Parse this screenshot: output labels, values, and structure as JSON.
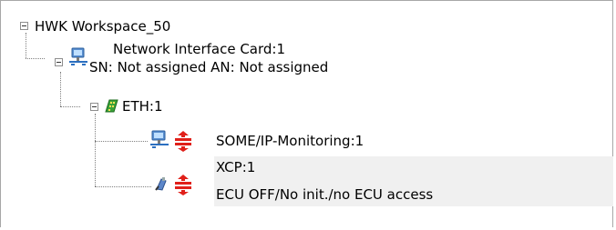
{
  "tree": {
    "root": {
      "label": "HWK Workspace_50"
    },
    "nic": {
      "line1": "Network Interface Card:1",
      "line2": "SN: Not assigned AN: Not assigned"
    },
    "eth": {
      "label": "ETH:1"
    },
    "someip": {
      "label": "SOME/IP-Monitoring:1"
    },
    "xcp": {
      "line1": "XCP:1",
      "line2": "ECU OFF/No init./no ECU access"
    }
  },
  "colors": {
    "connector": "#808080",
    "selection": "#f0f0f0",
    "protocol_red": "#e0201a",
    "monitor_blue": "#3a7fc8",
    "board_green": "#2f9a2a"
  },
  "icons": {
    "root_toggle": "collapse-box-icon",
    "nic_icon": "network-card-icon",
    "eth_icon": "ethernet-board-icon",
    "someip_icon": "monitor-network-icon",
    "xcp_icon": "ecu-plug-icon",
    "protocol_icon": "protocol-stack-icon"
  }
}
